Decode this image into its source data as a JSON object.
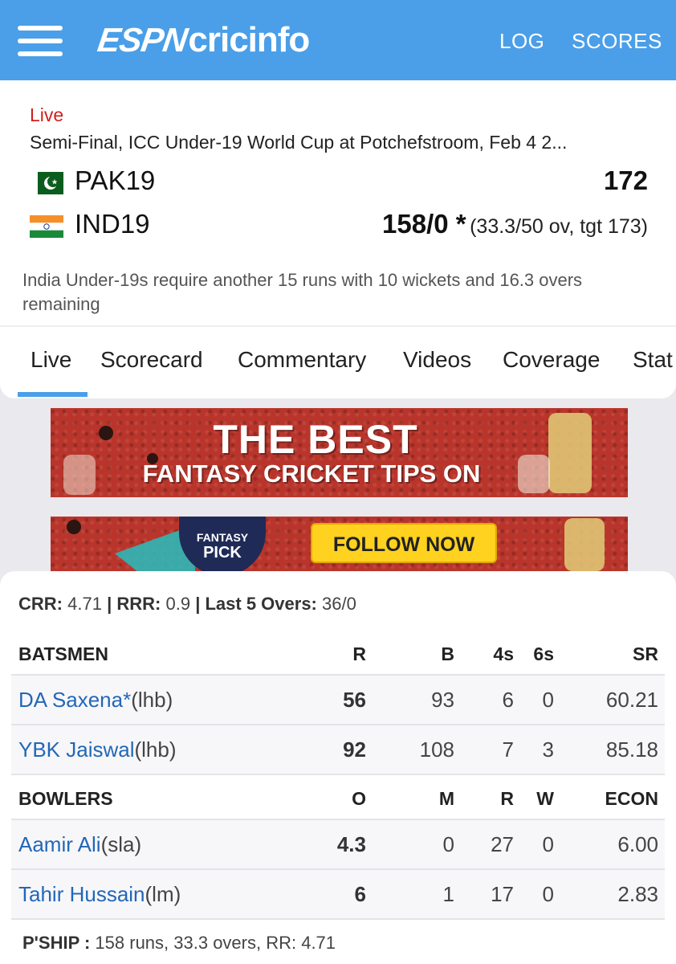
{
  "header": {
    "logo_espn": "ESPN",
    "logo_cricinfo": "cricinfo",
    "log_label": "LOG",
    "scores_label": "SCORES"
  },
  "match": {
    "live_label": "Live",
    "description": "Semi-Final, ICC Under-19 World Cup at Potchefstroom, Feb 4 2...",
    "team1": {
      "name": "PAK19",
      "score": "172"
    },
    "team2": {
      "name": "IND19",
      "score": "158/0 *",
      "extra": "(33.3/50 ov, tgt 173)"
    },
    "status": "India Under-19s require another 15 runs with 10 wickets and 16.3 overs remaining"
  },
  "tabs": [
    "Live",
    "Scorecard",
    "Commentary",
    "Videos",
    "Coverage",
    "Stat"
  ],
  "ads": {
    "ad1_line1": "THE BEST",
    "ad1_line2": "FANTASY CRICKET TIPS ON",
    "ad2_badge_top": "FANTASY",
    "ad2_badge_bottom": "PICK",
    "ad2_button": "FOLLOW NOW"
  },
  "rates": {
    "crr_label": "CRR:",
    "crr": "4.71",
    "rrr_label": "RRR:",
    "rrr": "0.9",
    "last5_label": "Last 5 Overs:",
    "last5": "36/0",
    "sep": "|"
  },
  "batsmen": {
    "headers": [
      "BATSMEN",
      "R",
      "B",
      "4s",
      "6s",
      "SR"
    ],
    "rows": [
      {
        "name": "DA Saxena*",
        "type": "(lhb)",
        "r": "56",
        "b": "93",
        "fours": "6",
        "sixes": "0",
        "sr": "60.21"
      },
      {
        "name": "YBK Jaiswal",
        "type": "(lhb)",
        "r": "92",
        "b": "108",
        "fours": "7",
        "sixes": "3",
        "sr": "85.18"
      }
    ]
  },
  "bowlers": {
    "headers": [
      "BOWLERS",
      "O",
      "M",
      "R",
      "W",
      "ECON"
    ],
    "rows": [
      {
        "name": "Aamir Ali",
        "type": "(sla)",
        "o": "4.3",
        "m": "0",
        "r": "27",
        "w": "0",
        "econ": "6.00"
      },
      {
        "name": "Tahir Hussain",
        "type": "(lm)",
        "o": "6",
        "m": "1",
        "r": "17",
        "w": "0",
        "econ": "2.83"
      }
    ]
  },
  "partnership": {
    "label": "P'SHIP :",
    "value": "158 runs, 33.3 overs, RR: 4.71"
  },
  "colors": {
    "brand_blue": "#4a9fe8",
    "live_red": "#d0201b",
    "player_link": "#2367b7"
  }
}
